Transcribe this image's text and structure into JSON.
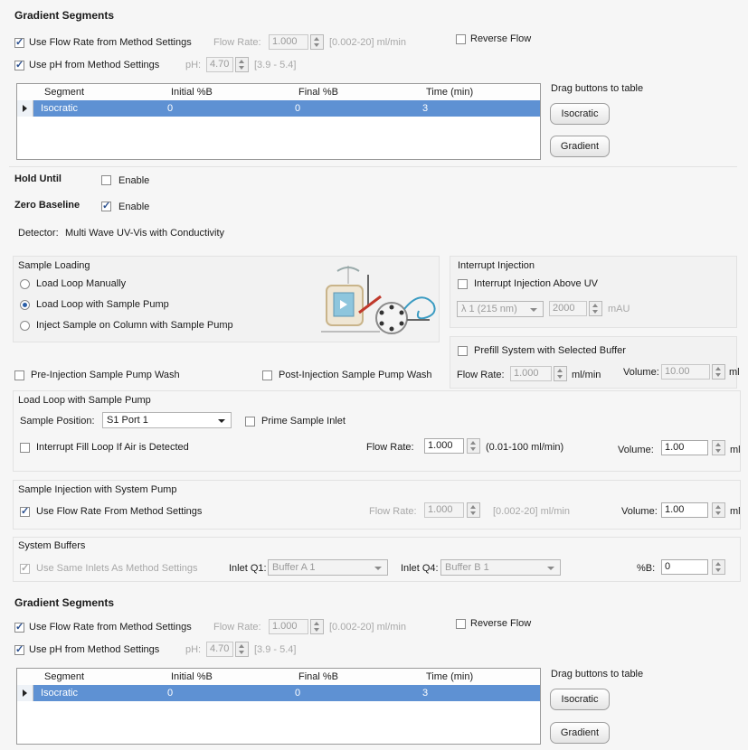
{
  "gradient_top": {
    "title": "Gradient Segments",
    "use_flow_label": "Use Flow Rate from Method Settings",
    "use_flow_checked": true,
    "flow_rate_label": "Flow Rate:",
    "flow_rate_value": "1.000",
    "flow_rate_range": "[0.002-20] ml/min",
    "reverse_flow_label": "Reverse Flow",
    "use_ph_label": "Use pH from Method Settings",
    "ph_label": "pH:",
    "ph_value": "4.70",
    "ph_range": "[3.9 - 5.4]",
    "columns": [
      "Segment",
      "Initial %B",
      "Final %B",
      "Time (min)"
    ],
    "row": [
      "Isocratic",
      "0",
      "0",
      "3"
    ],
    "drag_label": "Drag buttons to table",
    "btn_isocratic": "Isocratic",
    "btn_gradient": "Gradient"
  },
  "hold_until": {
    "label": "Hold Until",
    "enable": "Enable",
    "checked": false
  },
  "zero_baseline": {
    "label": "Zero Baseline",
    "enable": "Enable",
    "checked": true
  },
  "detector": {
    "label": "Detector:",
    "value": "Multi Wave UV-Vis with Conductivity"
  },
  "sample_loading": {
    "title": "Sample Loading",
    "options": [
      "Load Loop Manually",
      "Load Loop with Sample Pump",
      "Inject Sample on Column with Sample Pump"
    ],
    "selected_index": 1
  },
  "interrupt_injection": {
    "title": "Interrupt Injection",
    "checkbox_label": "Interrupt Injection Above UV",
    "wavelength": "λ 1 (215 nm)",
    "value": "2000",
    "unit": "mAU"
  },
  "prefill": {
    "checkbox_label": "Prefill System with Selected Buffer",
    "flow_label": "Flow Rate:",
    "flow_value": "1.000",
    "flow_unit": "ml/min",
    "volume_label": "Volume:",
    "volume_value": "10.00",
    "volume_unit": "ml"
  },
  "wash": {
    "pre": "Pre-Injection Sample Pump Wash",
    "post": "Post-Injection Sample Pump Wash"
  },
  "load_loop": {
    "title": "Load Loop with Sample Pump",
    "position_label": "Sample Position:",
    "position_value": "S1 Port 1",
    "prime_label": "Prime Sample Inlet",
    "interrupt_label": "Interrupt Fill Loop If Air is Detected",
    "flow_label": "Flow Rate:",
    "flow_value": "1.000",
    "flow_range": "(0.01-100 ml/min)",
    "volume_label": "Volume:",
    "volume_value": "1.00",
    "volume_unit": "ml"
  },
  "sample_injection": {
    "title": "Sample Injection with System Pump",
    "use_flow_label": "Use Flow Rate From Method Settings",
    "flow_label": "Flow Rate:",
    "flow_value": "1.000",
    "flow_range": "[0.002-20] ml/min",
    "volume_label": "Volume:",
    "volume_value": "1.00",
    "volume_unit": "ml"
  },
  "system_buffers": {
    "title": "System Buffers",
    "same_inlets_label": "Use Same Inlets As Method Settings",
    "q1_label": "Inlet Q1:",
    "q1_value": "Buffer A 1",
    "q4_label": "Inlet Q4:",
    "q4_value": "Buffer B 1",
    "b_label": "%B:",
    "b_value": "0"
  },
  "gradient_bottom": {
    "title": "Gradient Segments",
    "use_flow_label": "Use Flow Rate from Method Settings",
    "flow_rate_label": "Flow Rate:",
    "flow_rate_value": "1.000",
    "flow_rate_range": "[0.002-20] ml/min",
    "reverse_flow_label": "Reverse Flow",
    "use_ph_label": "Use pH from Method Settings",
    "ph_label": "pH:",
    "ph_value": "4.70",
    "ph_range": "[3.9 - 5.4]",
    "columns": [
      "Segment",
      "Initial %B",
      "Final %B",
      "Time (min)"
    ],
    "row": [
      "Isocratic",
      "0",
      "0",
      "3"
    ],
    "drag_label": "Drag buttons to table",
    "btn_isocratic": "Isocratic",
    "btn_gradient": "Gradient"
  },
  "icons": [
    "checkbox-icon",
    "radio-icon",
    "spin-icon",
    "dropdown-arrow-icon",
    "row-selector-icon",
    "sample-pump-diagram-icon"
  ],
  "colors": {
    "selection": "#5e91d3",
    "check": "#2a4f8f",
    "disabled_text": "#a8a8a8"
  }
}
